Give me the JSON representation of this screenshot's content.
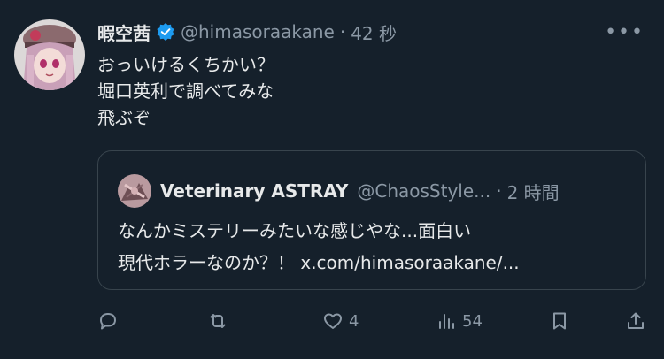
{
  "tweet": {
    "author_name": "暇空茜",
    "handle": "@himasoraakane",
    "separator": "·",
    "time": "42 秒",
    "more_label": "•••",
    "lines": [
      "おっいけるくちかい？",
      "堀口英利で調べてみな",
      "飛ぶぞ"
    ]
  },
  "quote": {
    "author_name": "Veterinary ASTRAY",
    "handle": "@ChaosStyle...",
    "separator": "·",
    "time": "2 時間",
    "lines": [
      "なんかミステリーみたいな感じやな...面白い",
      "現代ホラーなのか？！ x.com/himasoraakane/..."
    ]
  },
  "actions": {
    "reply_count": "",
    "retweet_count": "",
    "like_count": "4",
    "views_count": "54"
  },
  "colors": {
    "background": "#15202b",
    "text": "#e7e9ea",
    "muted": "#8b98a5",
    "verified": "#1d9bf0",
    "border": "#38444d"
  },
  "icons": [
    "verified-badge-icon",
    "more-icon",
    "reply-icon",
    "retweet-icon",
    "like-icon",
    "views-icon",
    "bookmark-icon",
    "share-icon"
  ]
}
